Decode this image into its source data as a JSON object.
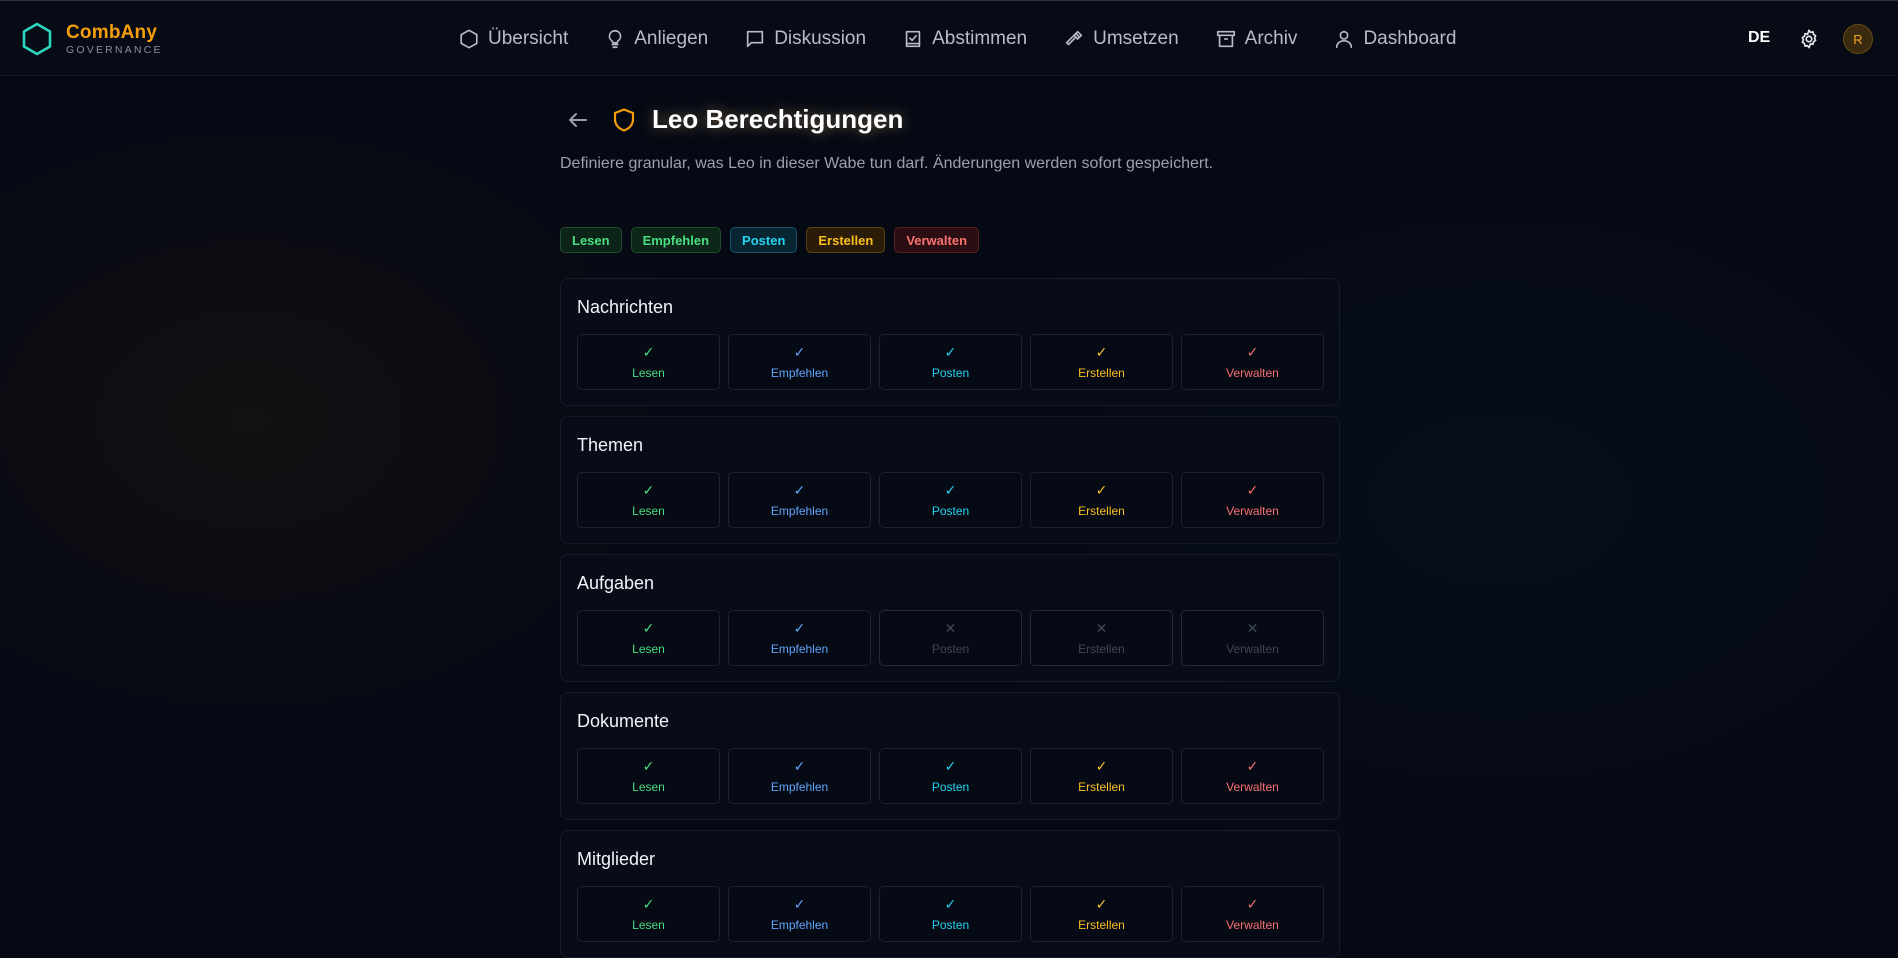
{
  "app": {
    "name": "CombAny",
    "subtitle": "GOVERNANCE"
  },
  "nav": [
    {
      "label": "Übersicht",
      "icon": "hexagon-icon"
    },
    {
      "label": "Anliegen",
      "icon": "lightbulb-icon"
    },
    {
      "label": "Diskussion",
      "icon": "chat-icon"
    },
    {
      "label": "Abstimmen",
      "icon": "ballot-icon"
    },
    {
      "label": "Umsetzen",
      "icon": "hammer-icon"
    },
    {
      "label": "Archiv",
      "icon": "archive-icon"
    },
    {
      "label": "Dashboard",
      "icon": "user-icon"
    }
  ],
  "header_right": {
    "lang": "DE",
    "avatar_initial": "R"
  },
  "page": {
    "title": "Leo Berechtigungen",
    "description": "Definiere granular, was Leo in dieser Wabe tun darf. Änderungen werden sofort gespeichert."
  },
  "legend": [
    "Lesen",
    "Empfehlen",
    "Posten",
    "Erstellen",
    "Verwalten"
  ],
  "colors": {
    "accent": "#f59e0b",
    "lesen": "#4ade80",
    "empfehlen": "#60a5fa",
    "posten": "#22d3ee",
    "erstellen": "#fbbf24",
    "verwalten": "#f87171"
  },
  "marks": {
    "on": "✓",
    "off": "✕"
  },
  "sections": [
    {
      "title": "Nachrichten",
      "perms": [
        {
          "label": "Lesen",
          "enabled": true
        },
        {
          "label": "Empfehlen",
          "enabled": true
        },
        {
          "label": "Posten",
          "enabled": true
        },
        {
          "label": "Erstellen",
          "enabled": true
        },
        {
          "label": "Verwalten",
          "enabled": true
        }
      ]
    },
    {
      "title": "Themen",
      "perms": [
        {
          "label": "Lesen",
          "enabled": true
        },
        {
          "label": "Empfehlen",
          "enabled": true
        },
        {
          "label": "Posten",
          "enabled": true
        },
        {
          "label": "Erstellen",
          "enabled": true
        },
        {
          "label": "Verwalten",
          "enabled": true
        }
      ]
    },
    {
      "title": "Aufgaben",
      "perms": [
        {
          "label": "Lesen",
          "enabled": true
        },
        {
          "label": "Empfehlen",
          "enabled": true
        },
        {
          "label": "Posten",
          "enabled": false
        },
        {
          "label": "Erstellen",
          "enabled": false
        },
        {
          "label": "Verwalten",
          "enabled": false
        }
      ]
    },
    {
      "title": "Dokumente",
      "perms": [
        {
          "label": "Lesen",
          "enabled": true
        },
        {
          "label": "Empfehlen",
          "enabled": true
        },
        {
          "label": "Posten",
          "enabled": true
        },
        {
          "label": "Erstellen",
          "enabled": true
        },
        {
          "label": "Verwalten",
          "enabled": true
        }
      ]
    },
    {
      "title": "Mitglieder",
      "perms": [
        {
          "label": "Lesen",
          "enabled": true
        },
        {
          "label": "Empfehlen",
          "enabled": true
        },
        {
          "label": "Posten",
          "enabled": true
        },
        {
          "label": "Erstellen",
          "enabled": true
        },
        {
          "label": "Verwalten",
          "enabled": true
        }
      ]
    }
  ]
}
